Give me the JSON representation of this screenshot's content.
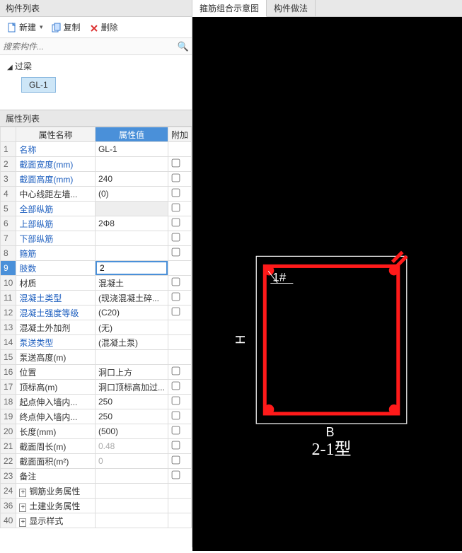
{
  "left": {
    "list_header": "构件列表",
    "toolbar": {
      "new": "新建",
      "copy": "复制",
      "delete": "删除"
    },
    "search_placeholder": "搜索构件...",
    "tree": {
      "root": "过梁",
      "child": "GL-1",
      "root_collapse": "◢"
    },
    "prop_header": "属性列表",
    "columns": {
      "name": "属性名称",
      "value": "属性值",
      "add": "附加"
    },
    "rows": [
      {
        "n": 1,
        "name": "名称",
        "value": "GL-1",
        "blue": true,
        "add": null
      },
      {
        "n": 2,
        "name": "截面宽度(mm)",
        "value": "",
        "blue": true,
        "add": true
      },
      {
        "n": 3,
        "name": "截面高度(mm)",
        "value": "240",
        "blue": true,
        "add": true
      },
      {
        "n": 4,
        "name": "中心线距左墙...",
        "value": "(0)",
        "blue": false,
        "add": true
      },
      {
        "n": 5,
        "name": "全部纵筋",
        "value": "",
        "blue": true,
        "greyval": true,
        "add": true
      },
      {
        "n": 6,
        "name": "上部纵筋",
        "value": "2Φ8",
        "blue": true,
        "add": true
      },
      {
        "n": 7,
        "name": "下部纵筋",
        "value": "",
        "blue": true,
        "add": true
      },
      {
        "n": 8,
        "name": "箍筋",
        "value": "",
        "blue": true,
        "add": true
      },
      {
        "n": 9,
        "name": "肢数",
        "value": "2",
        "blue": true,
        "editing": true,
        "selected": true,
        "add": null
      },
      {
        "n": 10,
        "name": "材质",
        "value": "混凝土",
        "blue": false,
        "add": true
      },
      {
        "n": 11,
        "name": "混凝土类型",
        "value": "(现浇混凝土碎...",
        "blue": true,
        "add": true
      },
      {
        "n": 12,
        "name": "混凝土强度等级",
        "value": "(C20)",
        "blue": true,
        "add": true
      },
      {
        "n": 13,
        "name": "混凝土外加剂",
        "value": "(无)",
        "blue": false,
        "add": null
      },
      {
        "n": 14,
        "name": "泵送类型",
        "value": "(混凝土泵)",
        "blue": true,
        "add": null
      },
      {
        "n": 15,
        "name": "泵送高度(m)",
        "value": "",
        "blue": false,
        "add": null
      },
      {
        "n": 16,
        "name": "位置",
        "value": "洞口上方",
        "blue": false,
        "add": true
      },
      {
        "n": 17,
        "name": "顶标高(m)",
        "value": "洞口顶标高加过...",
        "blue": false,
        "add": true
      },
      {
        "n": 18,
        "name": "起点伸入墙内...",
        "value": "250",
        "blue": false,
        "add": true
      },
      {
        "n": 19,
        "name": "终点伸入墙内...",
        "value": "250",
        "blue": false,
        "add": true
      },
      {
        "n": 20,
        "name": "长度(mm)",
        "value": "(500)",
        "blue": false,
        "add": true
      },
      {
        "n": 21,
        "name": "截面周长(m)",
        "value": "0.48",
        "blue": false,
        "grey": true,
        "add": true
      },
      {
        "n": 22,
        "name": "截面面积(m²)",
        "value": "0",
        "blue": false,
        "grey": true,
        "add": true
      },
      {
        "n": 23,
        "name": "备注",
        "value": "",
        "blue": false,
        "add": true
      },
      {
        "n": 24,
        "name": "钢筋业务属性",
        "value": "",
        "blue": false,
        "expander": true,
        "add": null
      },
      {
        "n": 36,
        "name": "土建业务属性",
        "value": "",
        "blue": false,
        "expander": true,
        "add": null
      },
      {
        "n": 40,
        "name": "显示样式",
        "value": "",
        "blue": false,
        "expander": true,
        "add": null
      }
    ]
  },
  "right": {
    "tabs": {
      "diagram": "箍筋组合示意图",
      "method": "构件做法"
    },
    "labels": {
      "h": "H",
      "b": "B",
      "type": "2-1型",
      "rebar": "1#"
    }
  }
}
